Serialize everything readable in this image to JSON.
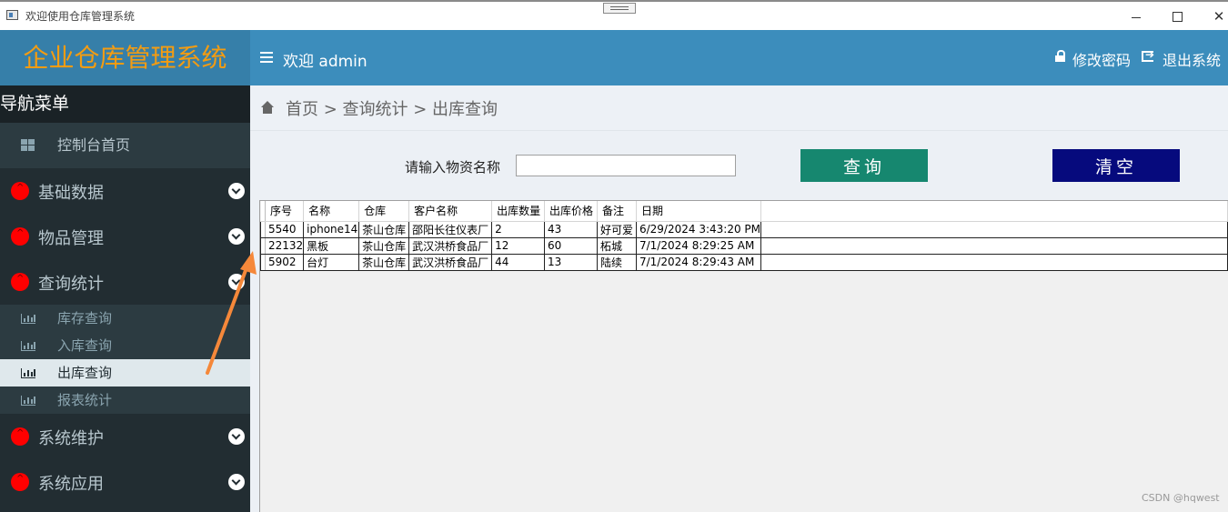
{
  "window": {
    "title": "欢迎使用仓库管理系统"
  },
  "logo": {
    "text": "企业仓库管理系统"
  },
  "header": {
    "welcome": "欢迎 admin",
    "change_password": "修改密码",
    "logout": "退出系统"
  },
  "sidebar": {
    "title": "导航菜单",
    "home": "控制台首页",
    "groups": {
      "basic": "基础数据",
      "goods": "物品管理",
      "query": "查询统计",
      "maintenance": "系统维护",
      "apps": "系统应用"
    },
    "query_items": [
      "库存查询",
      "入库查询",
      "出库查询",
      "报表统计"
    ]
  },
  "breadcrumb": {
    "text": "首页 > 查询统计 > 出库查询"
  },
  "search": {
    "label": "请输入物资名称",
    "value": "",
    "query_button": "查询",
    "clear_button": "清空"
  },
  "table": {
    "columns": [
      "序号",
      "名称",
      "仓库",
      "客户名称",
      "出库数量",
      "出库价格",
      "备注",
      "日期"
    ],
    "rows": [
      [
        "5540",
        "iphone14",
        "茶山仓库",
        "邵阳长往仪表厂",
        "2",
        "43",
        "好可爱",
        "6/29/2024 3:43:20 PM"
      ],
      [
        "22132",
        "黑板",
        "茶山仓库",
        "武汉洪桥食品厂",
        "12",
        "60",
        "柘城",
        "7/1/2024 8:29:25 AM"
      ],
      [
        "5902",
        "台灯",
        "茶山仓库",
        "武汉洪桥食品厂",
        "44",
        "13",
        "陆续",
        "7/1/2024 8:29:43 AM"
      ]
    ]
  },
  "watermark": "CSDN @hqwest",
  "colors": {
    "header": "#3c8dbc",
    "logo_bg": "#367fa9",
    "logo_text": "#f39c12",
    "sidebar": "#222d32",
    "query_button": "#16876f",
    "clear_button": "#060a7d",
    "arrow": "#f5883a"
  }
}
